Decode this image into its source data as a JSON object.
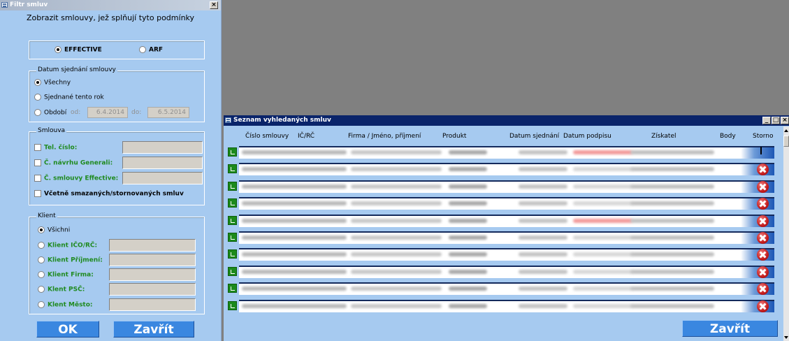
{
  "filter_window": {
    "title": "Filtr smluv",
    "close_label": "×",
    "subtitle": "Zobrazit smlouvy, jež splňují tyto podmínky",
    "source": {
      "effective": "EFFECTIVE",
      "arf": "ARF",
      "selected": "EFFECTIVE"
    },
    "date_group": {
      "label": "Datum sjednání smlouvy",
      "all": "Všechny",
      "this_year": "Sjednané tento rok",
      "period": "Období",
      "from_label": "od:",
      "from_value": "6.4.2014",
      "to_label": "do:",
      "to_value": "6.5.2014"
    },
    "contract_group": {
      "label": "Smlouva",
      "tel": "Tel. číslo:",
      "proposal": "Č. návrhu Generali:",
      "contract": "Č. smlouvy Effective:",
      "include_deleted": "Včetně smazaných/stornovaných smluv"
    },
    "client_group": {
      "label": "Klient",
      "all": "Všichni",
      "ico": "Klient IČO/RČ:",
      "surname": "Klient Příjmení:",
      "company": "Klient Firma:",
      "zip": "Klent PSČ:",
      "city": "Klent Město:"
    },
    "ok_label": "OK",
    "close_button_label": "Zavřít"
  },
  "list_window": {
    "title": "Seznam vyhledaných smluv",
    "columns": [
      "Číslo smlouvy",
      "IČ/RČ",
      "Firma / Jméno, příjmení",
      "Produkt",
      "Datum sjednání",
      "Datum podpisu",
      "Získatel",
      "Body",
      "Storno"
    ],
    "rows": [
      {
        "storno": false,
        "highlight": true
      },
      {
        "storno": true,
        "highlight": false
      },
      {
        "storno": true,
        "highlight": false
      },
      {
        "storno": true,
        "highlight": false
      },
      {
        "storno": true,
        "highlight": true
      },
      {
        "storno": true,
        "highlight": false
      },
      {
        "storno": true,
        "highlight": false
      },
      {
        "storno": true,
        "highlight": false
      },
      {
        "storno": true,
        "highlight": false
      },
      {
        "storno": true,
        "highlight": false
      }
    ],
    "close_button_label": "Zavřít"
  },
  "colors": {
    "panel": "#a6caf0",
    "button": "#3a87e0",
    "label_green": "#1f8a1f",
    "list_title": "#0a246a"
  }
}
